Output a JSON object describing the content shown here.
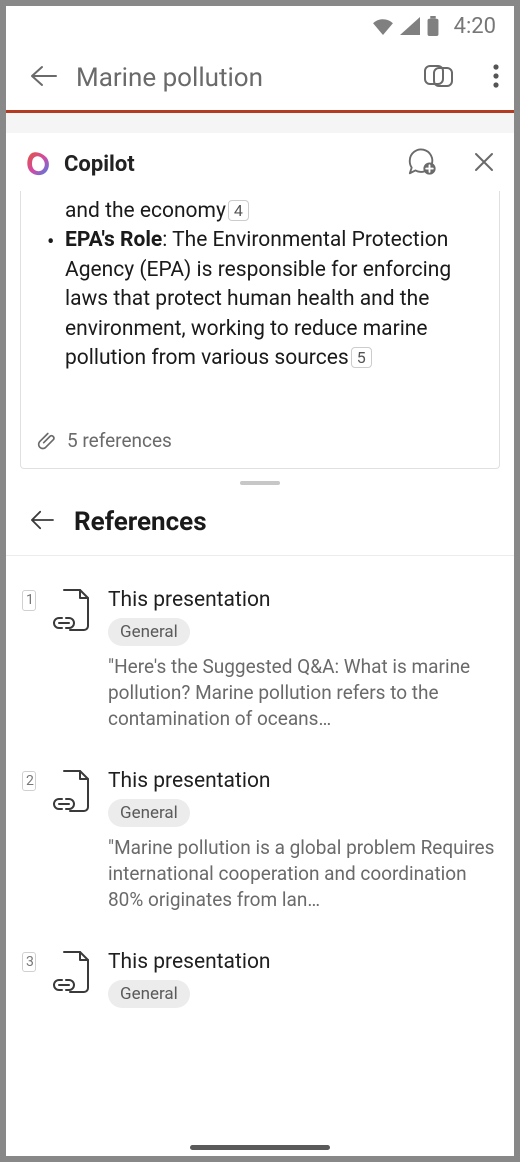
{
  "status": {
    "time": "4:20"
  },
  "header": {
    "title": "Marine pollution"
  },
  "copilot": {
    "title": "Copilot",
    "response": {
      "trailing_line": "and the economy",
      "trailing_citation": "4",
      "bullet": {
        "label": "EPA's Role",
        "text": ": The Environmental Protection Agency (EPA) is responsible for enforcing laws that protect human health and the environment, working to reduce marine pollution from various sources",
        "citation": "5"
      }
    },
    "references_note": "5 references"
  },
  "references": {
    "title": "References",
    "items": [
      {
        "title": "This presentation",
        "tag": "General",
        "snippet": "\"Here's the Suggested Q&A:   What is marine pollution?   Marine pollution refers to the contamination of oceans…"
      },
      {
        "title": "This presentation",
        "tag": "General",
        "snippet": "\"Marine pollution is a global problem Requires international cooperation and coordination 80% originates from lan…"
      },
      {
        "title": "This presentation",
        "tag": "General",
        "snippet": ""
      }
    ]
  }
}
